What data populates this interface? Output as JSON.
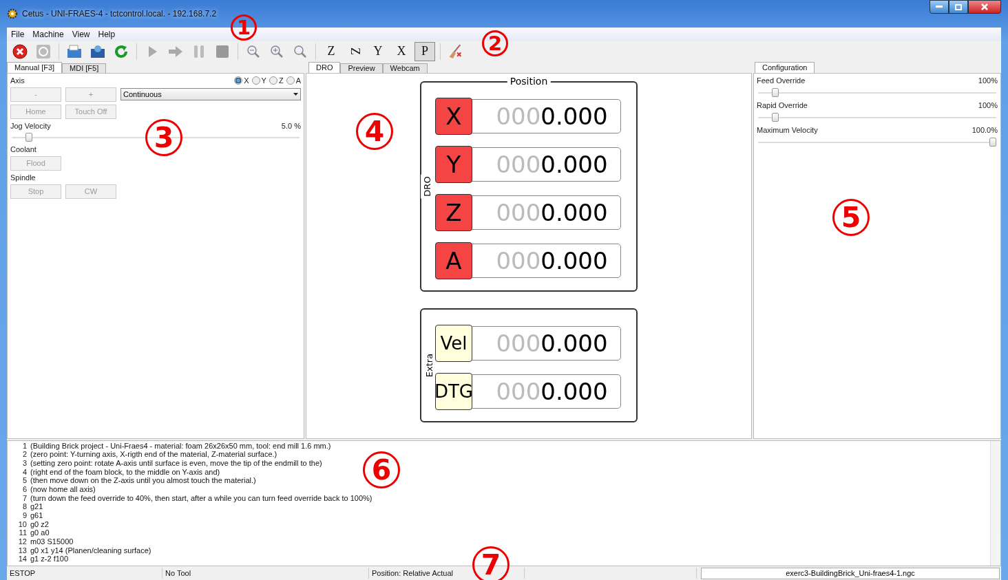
{
  "window": {
    "title": "Cetus - UNI-FRAES-4 - tctcontrol.local. - 192.168.7.2"
  },
  "menu": [
    "File",
    "Machine",
    "View",
    "Help"
  ],
  "toolbar": [
    {
      "kind": "estop"
    },
    {
      "kind": "power"
    },
    {
      "kind": "open"
    },
    {
      "kind": "open_remote"
    },
    {
      "kind": "reload"
    },
    {
      "kind": "run"
    },
    {
      "kind": "step"
    },
    {
      "kind": "pause"
    },
    {
      "kind": "stop"
    },
    {
      "kind": "zoom_out"
    },
    {
      "kind": "zoom_in"
    },
    {
      "kind": "zoom_fit"
    },
    {
      "kind": "view",
      "label": "Z",
      "rotated": false,
      "selected": false
    },
    {
      "kind": "view",
      "label": "Z",
      "rotated": true,
      "selected": false
    },
    {
      "kind": "view",
      "label": "Y",
      "rotated": false,
      "selected": false
    },
    {
      "kind": "view",
      "label": "X",
      "rotated": false,
      "selected": false
    },
    {
      "kind": "view",
      "label": "P",
      "rotated": false,
      "selected": true
    },
    {
      "kind": "clear"
    }
  ],
  "left_tabs": [
    {
      "label": "Manual [F3]",
      "selected": true
    },
    {
      "label": "MDI [F5]",
      "selected": false
    }
  ],
  "manual": {
    "axis_label": "Axis",
    "axes": [
      {
        "label": "X",
        "selected": true
      },
      {
        "label": "Y",
        "selected": false
      },
      {
        "label": "Z",
        "selected": false
      },
      {
        "label": "A",
        "selected": false
      }
    ],
    "jog_buttons": [
      "-",
      "+"
    ],
    "increment": "Continuous",
    "home_buttons": [
      "Home",
      "Touch Off"
    ],
    "jog_velocity": {
      "label": "Jog Velocity",
      "reading": "5.0 %",
      "level": 0.05
    },
    "coolant_label": "Coolant",
    "coolant_buttons": [
      "Flood"
    ],
    "spindle_label": "Spindle",
    "spindle_buttons": [
      "Stop",
      "CW"
    ]
  },
  "center_tabs": [
    {
      "label": "DRO",
      "selected": true
    },
    {
      "label": "Preview",
      "selected": false
    },
    {
      "label": "Webcam",
      "selected": false
    }
  ],
  "dro": {
    "side_label": "DRO",
    "title": "Position",
    "rows": [
      {
        "axis": "X",
        "color": "#f44444",
        "leading": "000",
        "value": "0.000"
      },
      {
        "axis": "Y",
        "color": "#f44444",
        "leading": "000",
        "value": "0.000"
      },
      {
        "axis": "Z",
        "color": "#f44444",
        "leading": "000",
        "value": "0.000"
      },
      {
        "axis": "A",
        "color": "#f44444",
        "leading": "000",
        "value": "0.000"
      }
    ]
  },
  "extra": {
    "side_label": "Extra",
    "rows": [
      {
        "axis": "Vel",
        "color": "#ffffdd",
        "leading": "000",
        "value": "0.000"
      },
      {
        "axis": "DTG",
        "color": "#ffffdd",
        "leading": "000",
        "value": "0.000"
      }
    ]
  },
  "right_tabs": [
    {
      "label": "Configuration",
      "selected": true
    }
  ],
  "overrides": [
    {
      "label": "Feed Override",
      "reading": "100%",
      "level": 0.06
    },
    {
      "label": "Rapid Override",
      "reading": "100%",
      "level": 0.06
    },
    {
      "label": "Maximum Velocity",
      "reading": "100.0%",
      "level": 1.0
    }
  ],
  "gcode": [
    {
      "number": "1",
      "text": "(Building Brick project - Uni-Fraes4 - material: foam 26x26x50 mm, tool: end mill 1.6 mm.)"
    },
    {
      "number": "2",
      "text": "(zero point: Y-turning axis, X-rigth end of the material, Z-material surface.)"
    },
    {
      "number": "3",
      "text": "(setting zero point: rotate A-axis until surface is even, move the tip of the endmill to the)"
    },
    {
      "number": "4",
      "text": "(right end of the foam block, to the middle on Y-axis and)"
    },
    {
      "number": "5",
      "text": "(then move down on the Z-axis until you almost touch the material.)"
    },
    {
      "number": "6",
      "text": "(now home all axis)"
    },
    {
      "number": "7",
      "text": "(turn down the feed override to 40%, then start, after a while you can turn feed override back to 100%)"
    },
    {
      "number": "8",
      "text": "g21"
    },
    {
      "number": "9",
      "text": "g61"
    },
    {
      "number": "10",
      "text": "g0 z2"
    },
    {
      "number": "11",
      "text": "g0 a0"
    },
    {
      "number": "12",
      "text": "m03 S15000"
    },
    {
      "number": "13",
      "text": "g0 x1 y14 (Planen/cleaning surface)"
    },
    {
      "number": "14",
      "text": "g1 z-2 f100"
    }
  ],
  "status_bar": [
    "ESTOP",
    "No Tool",
    "Position: Relative Actual",
    "exerc3-BuildingBrick_Uni-fraes4-1.ngc"
  ],
  "annotations": [
    "1",
    "2",
    "3",
    "4",
    "5",
    "6",
    "7"
  ]
}
